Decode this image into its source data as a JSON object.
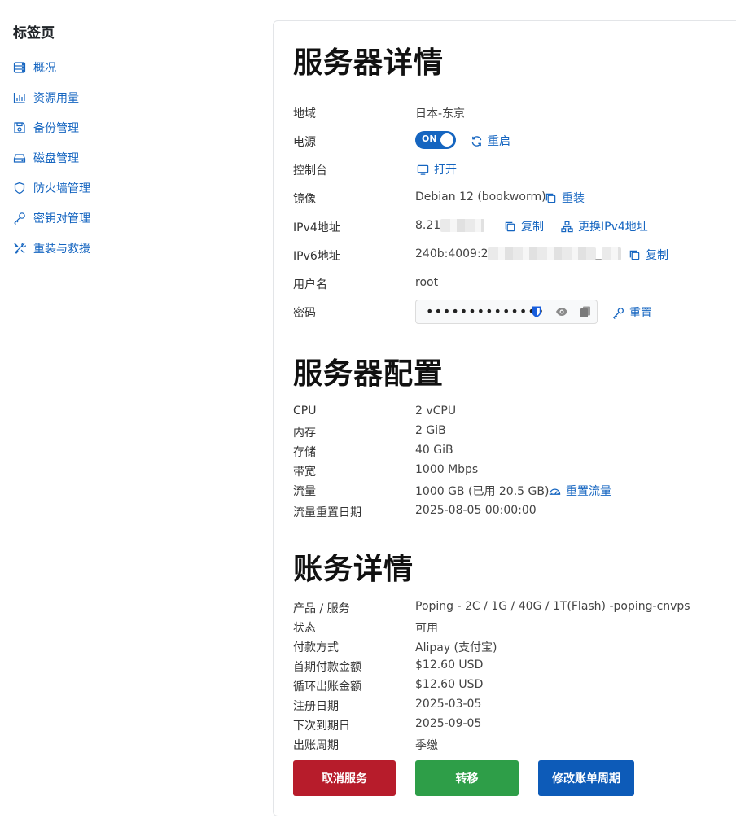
{
  "sidebar": {
    "title": "标签页",
    "items": [
      {
        "label": "概况",
        "icon": "server-icon"
      },
      {
        "label": "资源用量",
        "icon": "bar-chart-icon"
      },
      {
        "label": "备份管理",
        "icon": "save-icon"
      },
      {
        "label": "磁盘管理",
        "icon": "hdd-icon"
      },
      {
        "label": "防火墙管理",
        "icon": "shield-icon"
      },
      {
        "label": "密钥对管理",
        "icon": "key-icon"
      },
      {
        "label": "重装与救援",
        "icon": "tools-icon"
      }
    ]
  },
  "server_details": {
    "title": "服务器详情",
    "region_label": "地域",
    "region_value": "日本-东京",
    "power_label": "电源",
    "power_state": "ON",
    "restart_label": "重启",
    "console_label": "控制台",
    "console_open": "打开",
    "image_label": "镜像",
    "image_value": "Debian 12 (bookworm)",
    "reinstall_label": "重装",
    "ipv4_label": "IPv4地址",
    "ipv4_value": "8.21",
    "copy_label": "复制",
    "change_ipv4_label": "更换IPv4地址",
    "ipv6_label": "IPv6地址",
    "ipv6_value": "240b:4009:2",
    "ipv6_tail": "_",
    "username_label": "用户名",
    "username_value": "root",
    "password_label": "密码",
    "password_mask": "••••••••••••••",
    "password_reset": "重置"
  },
  "server_config": {
    "title": "服务器配置",
    "rows": [
      {
        "label": "CPU",
        "value": "2 vCPU"
      },
      {
        "label": "内存",
        "value": "2 GiB"
      },
      {
        "label": "存储",
        "value": "40 GiB"
      },
      {
        "label": "带宽",
        "value": "1000 Mbps"
      },
      {
        "label": "流量",
        "value": "1000 GB (已用 20.5 GB)"
      },
      {
        "label": "流量重置日期",
        "value": "2025-08-05 00:00:00"
      }
    ],
    "reset_traffic_label": "重置流量"
  },
  "billing": {
    "title": "账务详情",
    "rows": [
      {
        "label": "产品 / 服务",
        "value": "Poping - 2C / 1G / 40G / 1T(Flash) -poping-cnvps"
      },
      {
        "label": "状态",
        "value": "可用"
      },
      {
        "label": "付款方式",
        "value": "Alipay (支付宝)"
      },
      {
        "label": "首期付款金额",
        "value": "$12.60 USD"
      },
      {
        "label": "循环出账金额",
        "value": "$12.60 USD"
      },
      {
        "label": "注册日期",
        "value": "2025-03-05"
      },
      {
        "label": "下次到期日",
        "value": "2025-09-05"
      },
      {
        "label": "出账周期",
        "value": "季缴"
      }
    ]
  },
  "actions": {
    "cancel": "取消服务",
    "transfer": "转移",
    "change_cycle": "修改账单周期"
  },
  "colors": {
    "link": "#1565c0",
    "danger": "#b71c2b",
    "success": "#2e9e48",
    "primary": "#0d5bb8"
  }
}
